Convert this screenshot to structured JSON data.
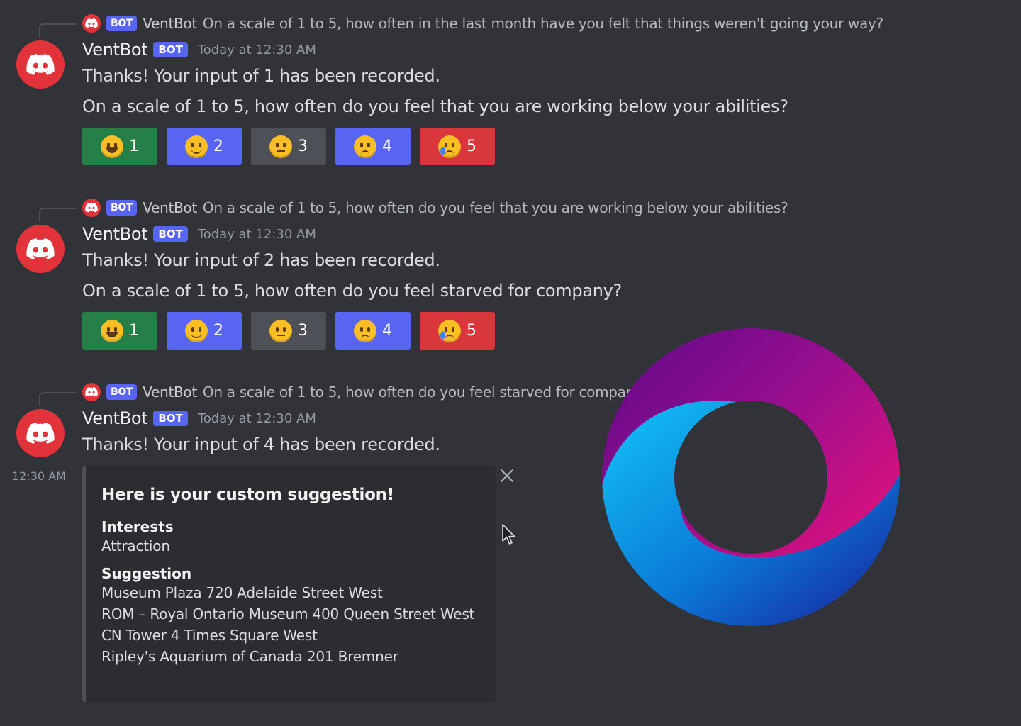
{
  "messages": [
    {
      "reply": {
        "bot_tag": "BOT",
        "name": "VentBot",
        "text": "On a scale of 1 to 5, how often in the last month have you felt that things weren't going your way?"
      },
      "username": "VentBot",
      "bot_tag": "BOT",
      "timestamp": "Today at 12:30 AM",
      "line1": "Thanks! Your input of 1 has been recorded.",
      "line2": "On a scale of 1 to 5, how often do you feel that you are working below your abilities?",
      "buttons": [
        "1",
        "2",
        "3",
        "4",
        "5"
      ]
    },
    {
      "reply": {
        "bot_tag": "BOT",
        "name": "VentBot",
        "text": "On a scale of 1 to 5, how often do you feel that you are working below your abilities?"
      },
      "username": "VentBot",
      "bot_tag": "BOT",
      "timestamp": "Today at 12:30 AM",
      "line1": "Thanks! Your input of 2 has been recorded.",
      "line2": "On a scale of 1 to 5, how often do you feel starved for company?",
      "buttons": [
        "1",
        "2",
        "3",
        "4",
        "5"
      ]
    },
    {
      "reply": {
        "bot_tag": "BOT",
        "name": "VentBot",
        "text": "On a scale of 1 to 5, how often do you feel starved for compar"
      },
      "username": "VentBot",
      "bot_tag": "BOT",
      "timestamp": "Today at 12:30 AM",
      "line1": "Thanks! Your input of 4 has been recorded."
    }
  ],
  "side_time": "12:30 AM",
  "embed": {
    "title": "Here is your custom suggestion!",
    "interests_label": "Interests",
    "interests_value": "Attraction",
    "suggestion_label": "Suggestion",
    "suggestions": [
      "Museum Plaza 720 Adelaide Street West",
      "ROM – Royal Ontario Museum 400 Queen Street West",
      "CN Tower 4 Times Square West",
      "Ripley's Aquarium of Canada 201 Bremner"
    ]
  },
  "icons": {
    "avatar": "discord-logo-icon",
    "close": "close-icon",
    "cursor": "mouse-pointer-icon",
    "overlay": "loading-ring-icon"
  },
  "colors": {
    "avatar": "#e3333a",
    "bot_tag": "#5865f2",
    "green": "#248046",
    "blue": "#5865f2",
    "gray": "#4e5058",
    "red": "#da373c",
    "background": "#313338"
  }
}
